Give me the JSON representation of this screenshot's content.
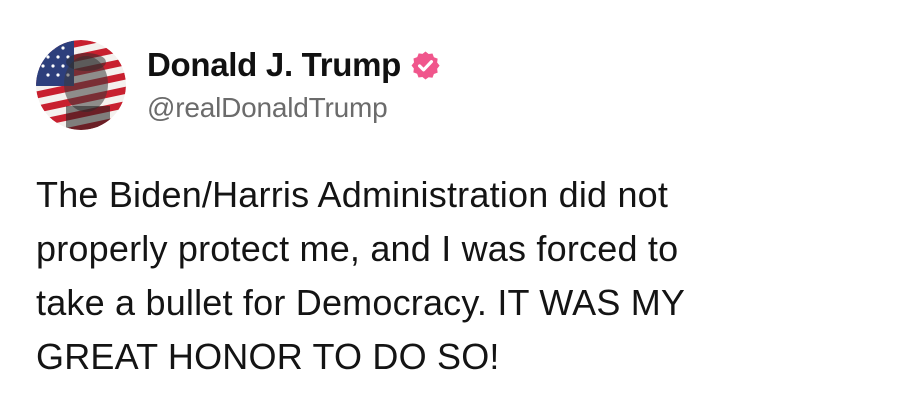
{
  "author": {
    "display_name": "Donald J. Trump",
    "handle": "@realDonaldTrump",
    "avatar_icon": "flag-portrait-avatar",
    "verified_icon": "verified-badge-icon",
    "verified_color": "#f0568c"
  },
  "post": {
    "lines": [
      "The Biden/Harris Administration did not",
      "properly protect me, and I was forced to",
      "take a bullet for Democracy. IT WAS MY",
      "GREAT HONOR TO DO SO!"
    ]
  }
}
